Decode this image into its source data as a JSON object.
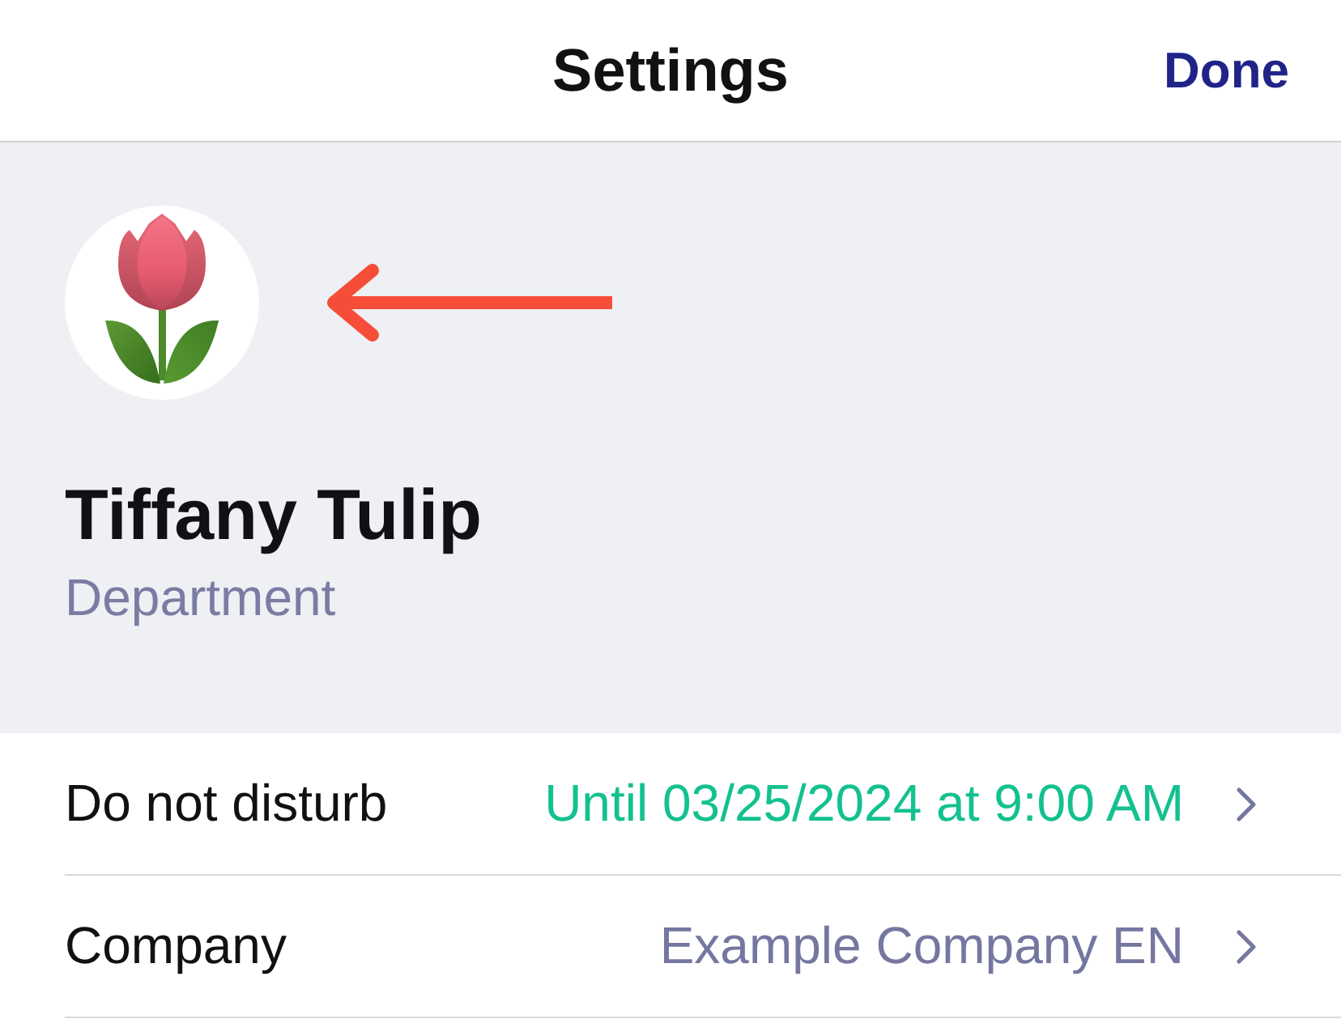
{
  "header": {
    "title": "Settings",
    "done_button": "Done"
  },
  "profile": {
    "name": "Tiffany Tulip",
    "department": "Department"
  },
  "rows": [
    {
      "label": "Do not disturb",
      "value": "Until 03/25/2024 at 9:00 AM",
      "color": "#13c18f"
    },
    {
      "label": "Company",
      "value": "Example Company EN",
      "color": "#7577a0"
    }
  ]
}
